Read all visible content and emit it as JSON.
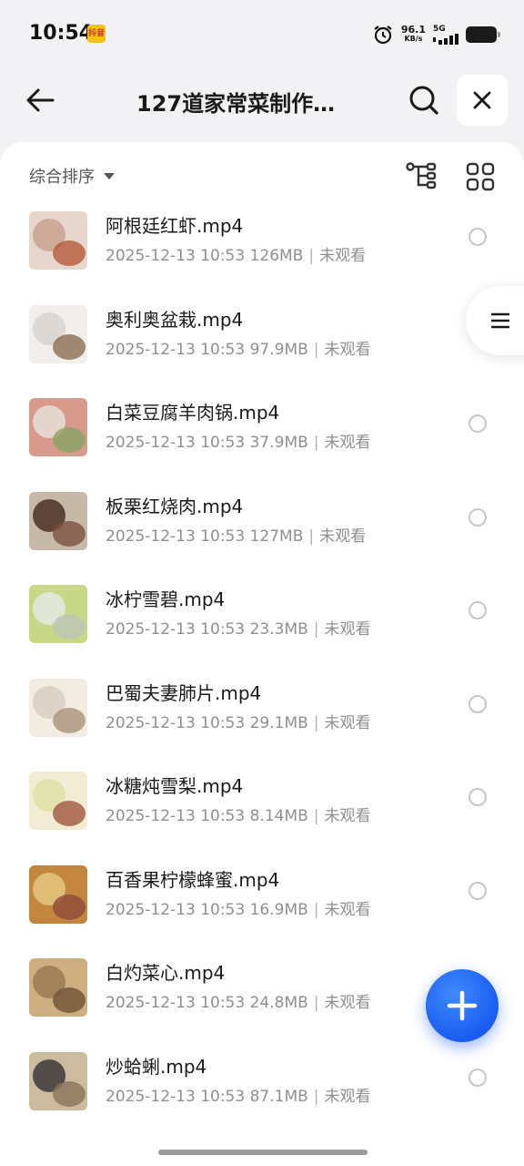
{
  "status_bar": {
    "time": "10:54",
    "app_badge": "抖音",
    "net_speed_value": "96.1",
    "net_speed_unit": "KB/s",
    "network_type": "5G",
    "icons": [
      "alarm-icon",
      "signal-icon",
      "battery-icon"
    ]
  },
  "header": {
    "title": "127道家常菜制作…",
    "back_icon": "back-arrow-icon",
    "search_icon": "search-icon",
    "close_icon": "close-icon"
  },
  "toolbar": {
    "sort_label": "综合排序",
    "tree_view_icon": "tree-view-icon",
    "grid_view_icon": "grid-view-icon"
  },
  "files": [
    {
      "name": "阿根廷红虾.mp4",
      "date": "2025-12-13 10:53",
      "size": "126MB",
      "status": "未观看",
      "colors": [
        "#c9a28f",
        "#e7d6cc",
        "#b55a3c"
      ]
    },
    {
      "name": "奥利奥盆栽.mp4",
      "date": "2025-12-13 10:53",
      "size": "97.9MB",
      "status": "未观看",
      "colors": [
        "#d9d3cf",
        "#f1eeec",
        "#8c6d52"
      ]
    },
    {
      "name": "白菜豆腐羊肉锅.mp4",
      "date": "2025-12-13 10:53",
      "size": "37.9MB",
      "status": "未观看",
      "colors": [
        "#e8e1d8",
        "#d79a8d",
        "#8aa365"
      ]
    },
    {
      "name": "板栗红烧肉.mp4",
      "date": "2025-12-13 10:53",
      "size": "127MB",
      "status": "未观看",
      "colors": [
        "#4b2f26",
        "#c7b9a8",
        "#7a5140"
      ]
    },
    {
      "name": "冰柠雪碧.mp4",
      "date": "2025-12-13 10:53",
      "size": "23.3MB",
      "status": "未观看",
      "colors": [
        "#e4e9e2",
        "#c9d887",
        "#bcc6b8"
      ]
    },
    {
      "name": "巴蜀夫妻肺片.mp4",
      "date": "2025-12-13 10:53",
      "size": "29.1MB",
      "status": "未观看",
      "colors": [
        "#d9cfc2",
        "#f3ece2",
        "#a8937c"
      ]
    },
    {
      "name": "冰糖炖雪梨.mp4",
      "date": "2025-12-13 10:53",
      "size": "8.14MB",
      "status": "未观看",
      "colors": [
        "#dfe0a8",
        "#f1ecd3",
        "#a1563f"
      ]
    },
    {
      "name": "百香果柠檬蜂蜜.mp4",
      "date": "2025-12-13 10:53",
      "size": "16.9MB",
      "status": "未观看",
      "colors": [
        "#e5c780",
        "#c4853f",
        "#8e4a3a"
      ]
    },
    {
      "name": "白灼菜心.mp4",
      "date": "2025-12-13 10:53",
      "size": "24.8MB",
      "status": "未观看",
      "colors": [
        "#9a7a52",
        "#cfae7f",
        "#6e5236"
      ]
    },
    {
      "name": "炒蛤蜊.mp4",
      "date": "2025-12-13 10:53",
      "size": "87.1MB",
      "status": "未观看",
      "colors": [
        "#3c3a38",
        "#cdbba0",
        "#8b7459"
      ]
    }
  ],
  "side_menu_icon": "menu-lines-icon",
  "fab_icon": "plus-icon",
  "accent_color": "#1a5cf0"
}
